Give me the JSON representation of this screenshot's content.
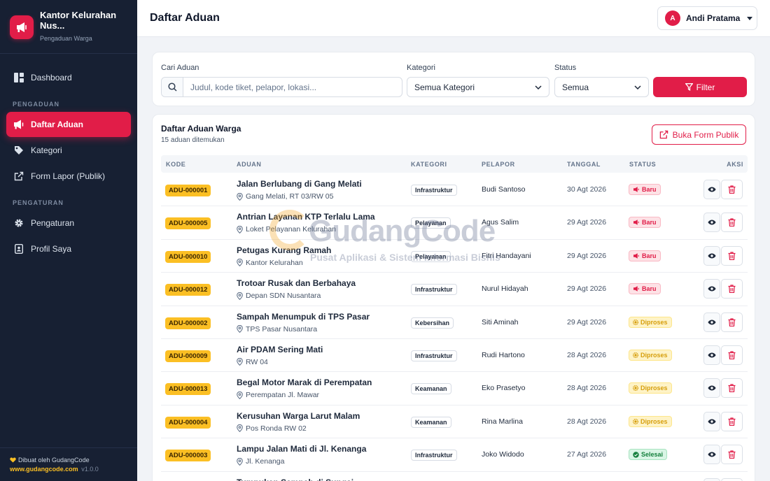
{
  "sidebar": {
    "brand_name": "Kantor Kelurahan Nus...",
    "brand_sub": "Pengaduan Warga",
    "items": [
      {
        "label": "Dashboard"
      },
      {
        "label": "Daftar Aduan"
      },
      {
        "label": "Kategori"
      },
      {
        "label": "Form Lapor (Publik)"
      },
      {
        "label": "Pengaturan"
      },
      {
        "label": "Profil Saya"
      }
    ],
    "section_pengaduan": "PENGADUAN",
    "section_pengaturan": "PENGATURAN",
    "footer_credit": "Dibuat oleh GudangCode",
    "footer_url": "www.gudangcode.com",
    "footer_version": "v1.0.0"
  },
  "header": {
    "title": "Daftar Aduan",
    "user_initial": "A",
    "user_name": "Andi Pratama"
  },
  "filters": {
    "search_label": "Cari Aduan",
    "search_placeholder": "Judul, kode tiket, pelapor, lokasi...",
    "category_label": "Kategori",
    "category_value": "Semua Kategori",
    "status_label": "Status",
    "status_value": "Semua",
    "filter_button": "Filter"
  },
  "list": {
    "title": "Daftar Aduan Warga",
    "count": "15 aduan ditemukan",
    "public_button": "Buka Form Publik",
    "columns": {
      "code": "KODE",
      "complaint": "ADUAN",
      "category": "KATEGORI",
      "reporter": "PELAPOR",
      "date": "TANGGAL",
      "status": "STATUS",
      "action": "AKSI"
    },
    "rows": [
      {
        "code": "ADU-000001",
        "title": "Jalan Berlubang di Gang Melati",
        "location": "Gang Melati, RT 03/RW 05",
        "category": "Infrastruktur",
        "reporter": "Budi Santoso",
        "date": "30 Agt 2026",
        "status": "Baru"
      },
      {
        "code": "ADU-000005",
        "title": "Antrian Layanan KTP Terlalu Lama",
        "location": "Loket Pelayanan Kelurahan",
        "category": "Pelayanan",
        "reporter": "Agus Salim",
        "date": "29 Agt 2026",
        "status": "Baru"
      },
      {
        "code": "ADU-000010",
        "title": "Petugas Kurang Ramah",
        "location": "Kantor Kelurahan",
        "category": "Pelayanan",
        "reporter": "Fitri Handayani",
        "date": "29 Agt 2026",
        "status": "Baru"
      },
      {
        "code": "ADU-000012",
        "title": "Trotoar Rusak dan Berbahaya",
        "location": "Depan SDN Nusantara",
        "category": "Infrastruktur",
        "reporter": "Nurul Hidayah",
        "date": "29 Agt 2026",
        "status": "Baru"
      },
      {
        "code": "ADU-000002",
        "title": "Sampah Menumpuk di TPS Pasar",
        "location": "TPS Pasar Nusantara",
        "category": "Kebersihan",
        "reporter": "Siti Aminah",
        "date": "29 Agt 2026",
        "status": "Diproses"
      },
      {
        "code": "ADU-000009",
        "title": "Air PDAM Sering Mati",
        "location": "RW 04",
        "category": "Infrastruktur",
        "reporter": "Rudi Hartono",
        "date": "28 Agt 2026",
        "status": "Diproses"
      },
      {
        "code": "ADU-000013",
        "title": "Begal Motor Marak di Perempatan",
        "location": "Perempatan Jl. Mawar",
        "category": "Keamanan",
        "reporter": "Eko Prasetyo",
        "date": "28 Agt 2026",
        "status": "Diproses"
      },
      {
        "code": "ADU-000004",
        "title": "Kerusuhan Warga Larut Malam",
        "location": "Pos Ronda RW 02",
        "category": "Keamanan",
        "reporter": "Rina Marlina",
        "date": "28 Agt 2026",
        "status": "Diproses"
      },
      {
        "code": "ADU-000003",
        "title": "Lampu Jalan Mati di Jl. Kenanga",
        "location": "Jl. Kenanga",
        "category": "Infrastruktur",
        "reporter": "Joko Widodo",
        "date": "27 Agt 2026",
        "status": "Selesai"
      },
      {
        "code": "",
        "title": "Tumpukan Sampah di Sungai",
        "location": "",
        "category": "",
        "reporter": "",
        "date": "",
        "status": ""
      }
    ]
  },
  "watermark": {
    "title": "GudangCode",
    "subtitle": "Pusat Aplikasi & Sistem Informasi Bisnis"
  },
  "colors": {
    "accent": "#e11d48",
    "sidebar_bg": "#172033",
    "code_badge": "#fbbf24"
  }
}
